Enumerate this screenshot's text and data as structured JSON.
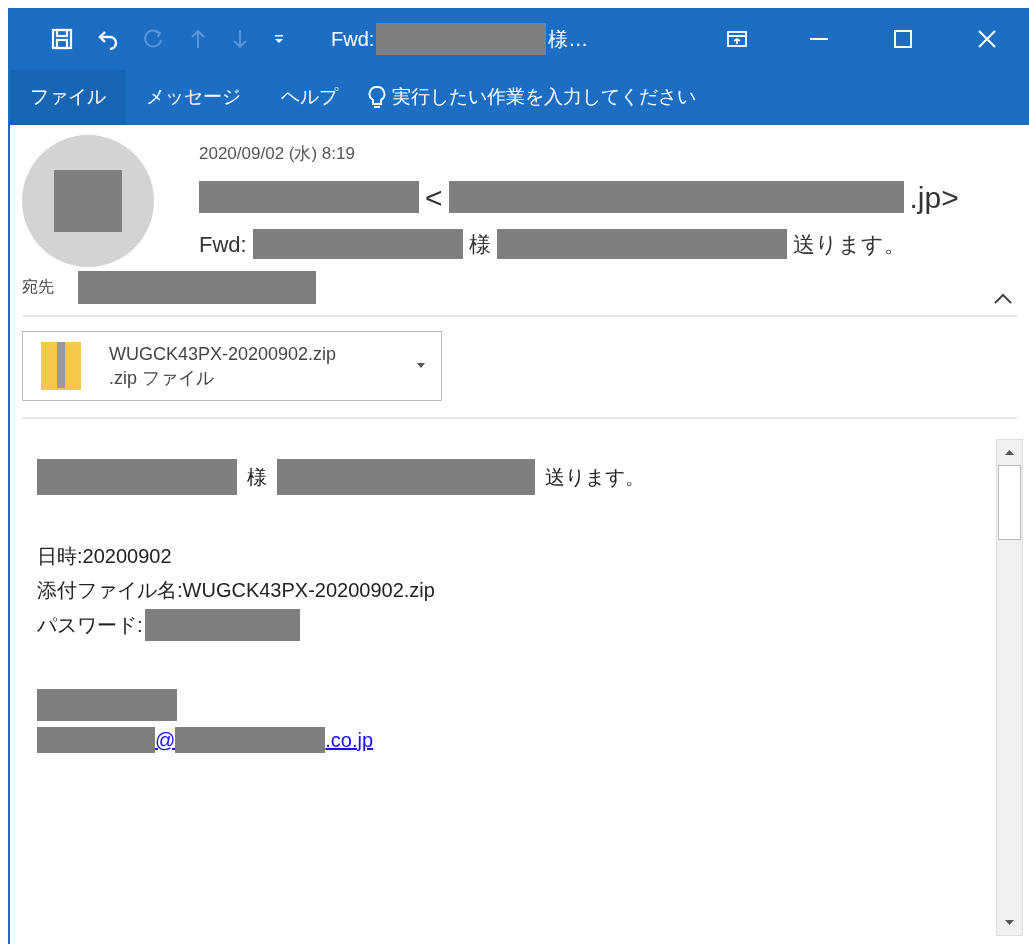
{
  "window": {
    "title": [
      {
        "kind": "text",
        "text": "Fwd:"
      },
      {
        "kind": "redacted"
      },
      {
        "kind": "text",
        "text": "様…"
      }
    ]
  },
  "quick_access": [
    {
      "disabled": false
    },
    {
      "disabled": false
    },
    {
      "disabled": true
    },
    {
      "disabled": true
    },
    {
      "disabled": true
    },
    {
      "disabled": false
    }
  ],
  "menu": [
    {
      "label": "ファイル",
      "selected": true
    },
    {
      "label": "メッセージ",
      "selected": false
    },
    {
      "label": "ヘルプ",
      "selected": false
    }
  ],
  "tell_me": {
    "placeholder": "実行したい作業を入力してください"
  },
  "message": {
    "date": "2020/09/02 (水) 8:19",
    "from": [
      {
        "kind": "redacted"
      },
      {
        "kind": "text",
        "text": "<"
      },
      {
        "kind": "redacted"
      },
      {
        "kind": "text",
        "text": ".jp>"
      }
    ],
    "subject": [
      {
        "kind": "text",
        "text": "Fwd:"
      },
      {
        "kind": "redacted"
      },
      {
        "kind": "text",
        "text": "様"
      },
      {
        "kind": "redacted"
      },
      {
        "kind": "text",
        "text": "送ります。"
      }
    ],
    "to_label": "宛先",
    "to": [
      {
        "kind": "redacted"
      }
    ],
    "expanded": true
  },
  "attachment": {
    "name": "WUGCK43PX-20200902.zip",
    "type": ".zip ファイル"
  },
  "body": [
    [
      {
        "kind": "redacted"
      },
      {
        "kind": "text",
        "text": "様"
      },
      {
        "kind": "redacted"
      },
      {
        "kind": "text",
        "text": "送ります。"
      }
    ],
    [
      {
        "kind": "gap"
      }
    ],
    [
      {
        "kind": "text",
        "text": "日時:20200902"
      }
    ],
    [
      {
        "kind": "text",
        "text": "添付ファイル名:WUGCK43PX-20200902.zip"
      }
    ],
    [
      {
        "kind": "text",
        "text": "パスワード:"
      },
      {
        "kind": "redacted"
      }
    ],
    [
      {
        "kind": "gap"
      }
    ],
    [
      {
        "kind": "gap"
      }
    ],
    [
      {
        "kind": "redacted"
      }
    ],
    [
      {
        "kind": "link",
        "parts": [
          {
            "kind": "redacted"
          },
          {
            "kind": "text",
            "text": "@"
          },
          {
            "kind": "redacted"
          },
          {
            "kind": "text",
            "text": ".co.jp"
          }
        ]
      }
    ]
  ]
}
